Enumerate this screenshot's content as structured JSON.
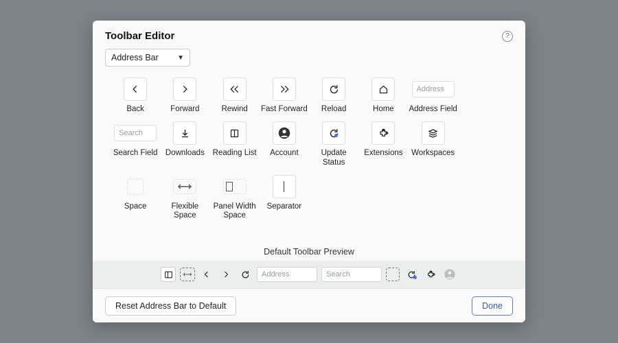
{
  "title": "Toolbar Editor",
  "target_selector": {
    "value": "Address Bar"
  },
  "tools": {
    "back": "Back",
    "forward": "Forward",
    "rewind": "Rewind",
    "fast_forward": "Fast Forward",
    "reload": "Reload",
    "home": "Home",
    "address_field": "Address Field",
    "address_placeholder": "Address",
    "search_field": "Search Field",
    "search_placeholder": "Search",
    "downloads": "Downloads",
    "reading_list": "Reading List",
    "account": "Account",
    "update_status": "Update Status",
    "extensions": "Extensions",
    "workspaces": "Workspaces",
    "space": "Space",
    "flexible_space": "Flexible Space",
    "panel_width_space": "Panel Width Space",
    "separator": "Separator"
  },
  "preview": {
    "heading": "Default Toolbar Preview",
    "address_placeholder": "Address",
    "search_placeholder": "Search"
  },
  "footer": {
    "reset": "Reset Address Bar to Default",
    "done": "Done"
  }
}
